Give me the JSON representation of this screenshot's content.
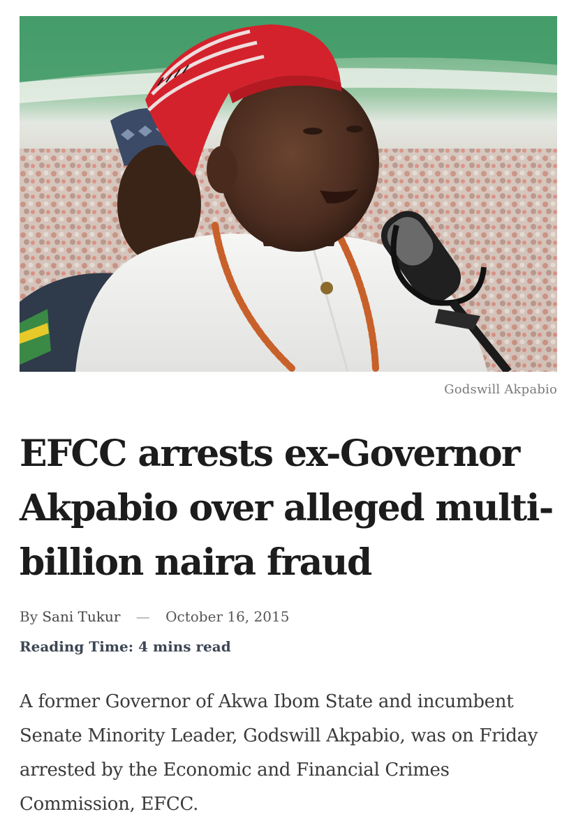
{
  "hero_image": {
    "subject": "man-in-red-cap-at-microphone"
  },
  "caption": "Godswill Akpabio",
  "headline": "EFCC arrests ex-Governor Akpabio over alleged multi-billion naira fraud",
  "meta": {
    "by_prefix": "By",
    "author": "Sani Tukur",
    "separator": "—",
    "date": "October 16, 2015"
  },
  "reading_time": {
    "label": "Reading Time:",
    "value": "4 mins read"
  },
  "body": "A former Governor of Akwa Ibom State and incumbent Senate Minority Leader, Godswill Akpabio, was on Friday arrested by the Economic and Financial Crimes Commission, EFCC.",
  "colors": {
    "headline": "#1c1c1c",
    "caption": "#7a7a7a",
    "reading_time": "#3d4654",
    "body": "#3a3a3a"
  }
}
